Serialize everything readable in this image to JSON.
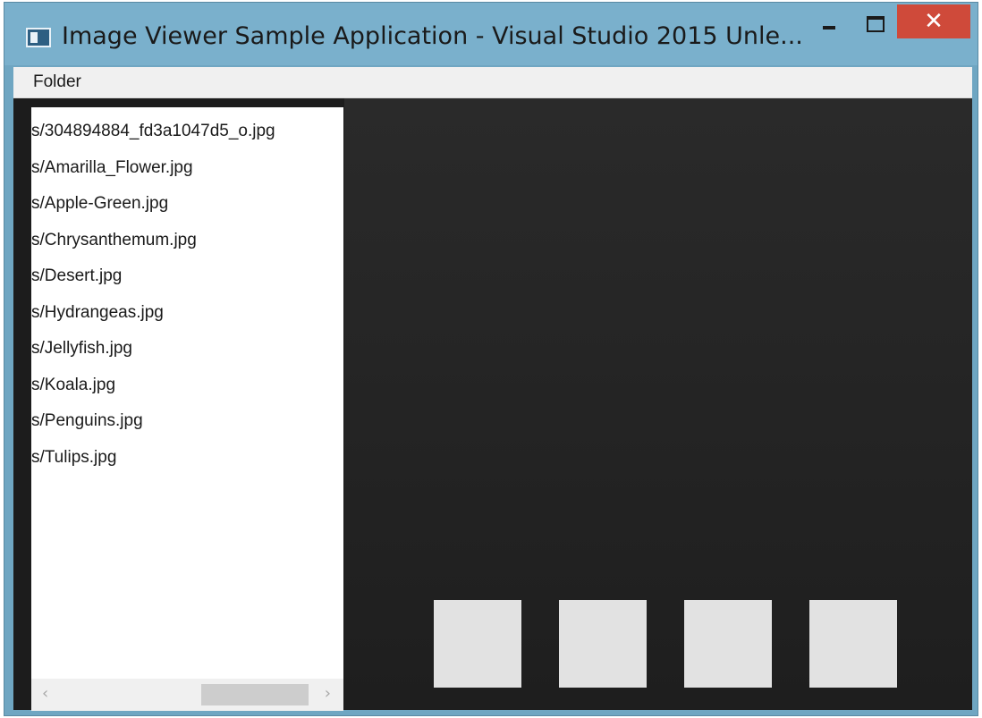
{
  "window": {
    "title": "Image Viewer Sample Application - Visual Studio 2015 Unle...",
    "close_glyph": "✕"
  },
  "menu": {
    "items": [
      {
        "label": "Folder"
      }
    ]
  },
  "file_list": {
    "items": [
      "s/304894884_fd3a1047d5_o.jpg",
      "s/Amarilla_Flower.jpg",
      "s/Apple-Green.jpg",
      "s/Chrysanthemum.jpg",
      "s/Desert.jpg",
      "s/Hydrangeas.jpg",
      "s/Jellyfish.jpg",
      "s/Koala.jpg",
      "s/Penguins.jpg",
      "s/Tulips.jpg"
    ]
  },
  "scrollbar": {
    "left_arrow": "‹",
    "right_arrow": "›"
  },
  "thumbnails": {
    "count": 4
  },
  "icons": {
    "app": "app-window-icon",
    "minimize": "minimize-icon",
    "maximize": "maximize-icon",
    "close": "close-icon"
  },
  "colors": {
    "frame": "#7ab0cc",
    "close": "#cf4a3a",
    "viewer_bg": "#232323",
    "thumb": "#e2e2e2"
  }
}
